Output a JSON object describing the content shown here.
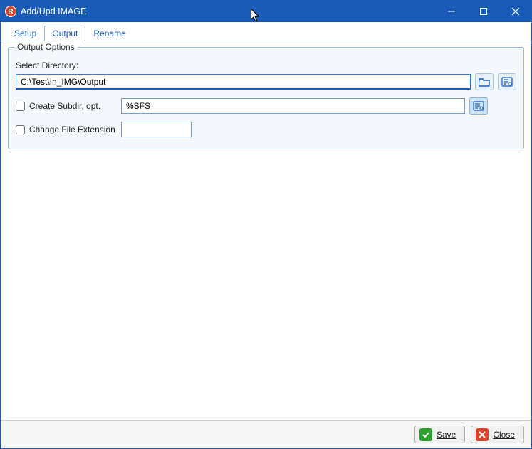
{
  "titlebar": {
    "app_icon_letter": "R",
    "title": "Add/Upd IMAGE"
  },
  "tabs": {
    "items": [
      {
        "label": "Setup",
        "active": false
      },
      {
        "label": "Output",
        "active": true
      },
      {
        "label": "Rename",
        "active": false
      }
    ]
  },
  "output_options": {
    "legend": "Output Options",
    "select_dir_label": "Select Directory:",
    "select_dir_value": "C:\\Test\\In_IMG\\Output",
    "create_subdir_label": "Create Subdir, opt.",
    "create_subdir_checked": false,
    "create_subdir_value": "%SFS",
    "change_ext_label": "Change File Extension",
    "change_ext_checked": false,
    "change_ext_value": ""
  },
  "footer": {
    "save_label": "Save",
    "close_label": "Close"
  }
}
